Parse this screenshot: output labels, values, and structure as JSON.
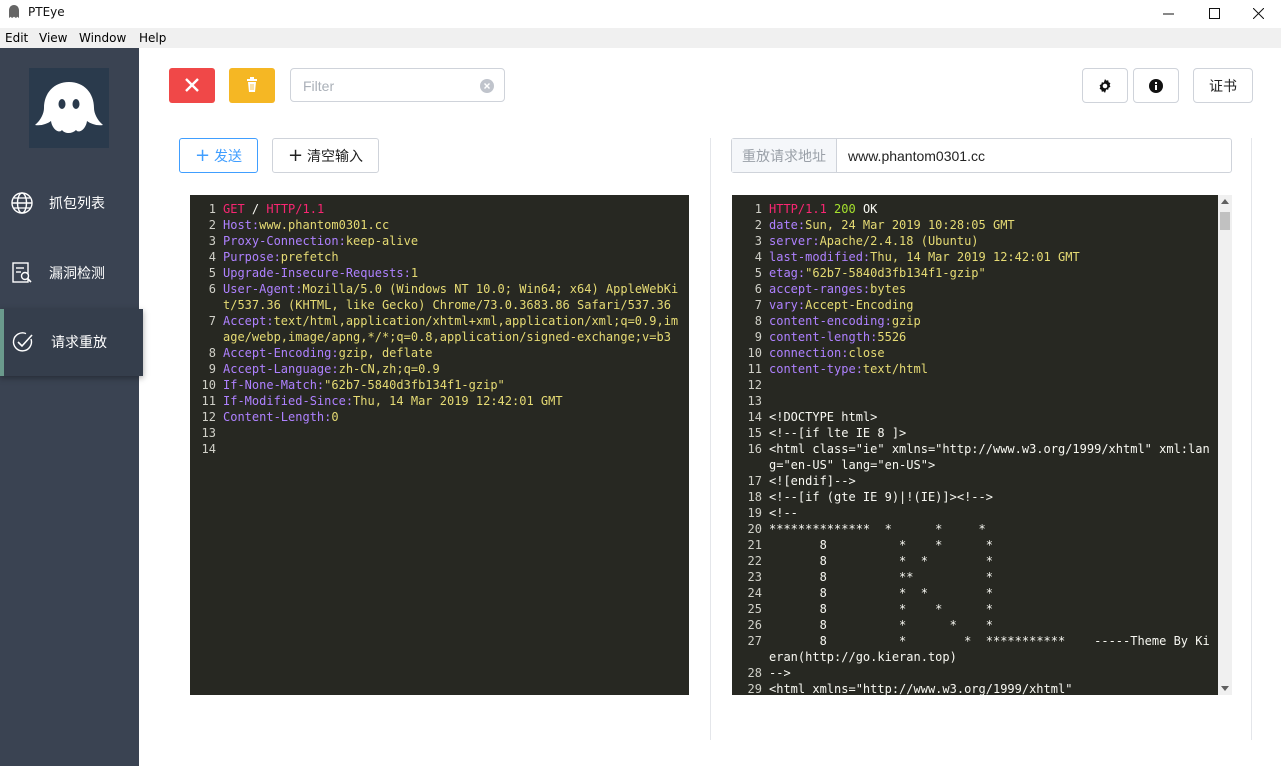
{
  "window": {
    "title": "PTEye"
  },
  "menu": [
    "Edit",
    "View",
    "Window",
    "Help"
  ],
  "sidebar": {
    "items": [
      {
        "label": "抓包列表",
        "icon": "globe-icon",
        "active": false
      },
      {
        "label": "漏洞检测",
        "icon": "report-icon",
        "active": false
      },
      {
        "label": "请求重放",
        "icon": "check-circle-icon",
        "active": true
      }
    ]
  },
  "toolbar": {
    "filter_placeholder": "Filter",
    "cert_label": "证书"
  },
  "actions": {
    "send_label": "发送",
    "clear_label": "清空输入"
  },
  "replay": {
    "address_label": "重放请求地址",
    "address_value": "www.phantom0301.cc"
  },
  "colors": {
    "sidebar": "#3a4352",
    "danger": "#f04848",
    "warning": "#f5b724",
    "primary": "#409eff",
    "editor_bg": "#272822"
  },
  "request": [
    [
      {
        "t": "GET",
        "c": "m"
      },
      {
        "t": " / ",
        "c": "w"
      },
      {
        "t": "HTTP/1.1",
        "c": "m"
      }
    ],
    [
      {
        "t": "Host:",
        "c": "k"
      },
      {
        "t": "www.phantom0301.cc",
        "c": "v"
      }
    ],
    [
      {
        "t": "Proxy-Connection:",
        "c": "k"
      },
      {
        "t": "keep-alive",
        "c": "v"
      }
    ],
    [
      {
        "t": "Purpose:",
        "c": "k"
      },
      {
        "t": "prefetch",
        "c": "v"
      }
    ],
    [
      {
        "t": "Upgrade-Insecure-Requests:",
        "c": "k"
      },
      {
        "t": "1",
        "c": "v"
      }
    ],
    [
      {
        "t": "User-Agent:",
        "c": "k"
      },
      {
        "t": "Mozilla/5.0 (Windows NT 10.0; Win64; x64) AppleWebKit/537.36 (KHTML, like Gecko) Chrome/73.0.3683.86 Safari/537.36",
        "c": "v"
      }
    ],
    [
      {
        "t": "Accept:",
        "c": "k"
      },
      {
        "t": "text/html,application/xhtml+xml,application/xml;q=0.9,image/webp,image/apng,*/*;q=0.8,application/signed-exchange;v=b3",
        "c": "v"
      }
    ],
    [
      {
        "t": "Accept-Encoding:",
        "c": "k"
      },
      {
        "t": "gzip, deflate",
        "c": "v"
      }
    ],
    [
      {
        "t": "Accept-Language:",
        "c": "k"
      },
      {
        "t": "zh-CN,zh;q=0.9",
        "c": "v"
      }
    ],
    [
      {
        "t": "If-None-Match:",
        "c": "k"
      },
      {
        "t": "\"62b7-5840d3fb134f1-gzip\"",
        "c": "v"
      }
    ],
    [
      {
        "t": "If-Modified-Since:",
        "c": "k"
      },
      {
        "t": "Thu, 14 Mar 2019 12:42:01 GMT",
        "c": "v"
      }
    ],
    [
      {
        "t": "Content-Length:",
        "c": "k"
      },
      {
        "t": "0",
        "c": "v"
      }
    ],
    [],
    []
  ],
  "response": [
    [
      {
        "t": "HTTP/1.1",
        "c": "m"
      },
      {
        "t": " ",
        "c": "w"
      },
      {
        "t": "200",
        "c": "g"
      },
      {
        "t": " OK",
        "c": "w"
      }
    ],
    [
      {
        "t": "date:",
        "c": "k"
      },
      {
        "t": "Sun, 24 Mar 2019 10:28:05 GMT",
        "c": "v"
      }
    ],
    [
      {
        "t": "server:",
        "c": "k"
      },
      {
        "t": "Apache/2.4.18 (Ubuntu)",
        "c": "v"
      }
    ],
    [
      {
        "t": "last-modified:",
        "c": "k"
      },
      {
        "t": "Thu, 14 Mar 2019 12:42:01 GMT",
        "c": "v"
      }
    ],
    [
      {
        "t": "etag:",
        "c": "k"
      },
      {
        "t": "\"62b7-5840d3fb134f1-gzip\"",
        "c": "v"
      }
    ],
    [
      {
        "t": "accept-ranges:",
        "c": "k"
      },
      {
        "t": "bytes",
        "c": "v"
      }
    ],
    [
      {
        "t": "vary:",
        "c": "k"
      },
      {
        "t": "Accept-Encoding",
        "c": "v"
      }
    ],
    [
      {
        "t": "content-encoding:",
        "c": "k"
      },
      {
        "t": "gzip",
        "c": "v"
      }
    ],
    [
      {
        "t": "content-length:",
        "c": "k"
      },
      {
        "t": "5526",
        "c": "v"
      }
    ],
    [
      {
        "t": "connection:",
        "c": "k"
      },
      {
        "t": "close",
        "c": "v"
      }
    ],
    [
      {
        "t": "content-type:",
        "c": "k"
      },
      {
        "t": "text/html",
        "c": "v"
      }
    ],
    [],
    [],
    [
      {
        "t": "<!DOCTYPE html>",
        "c": "w"
      }
    ],
    [
      {
        "t": "<!--[if lte IE 8 ]>",
        "c": "w"
      }
    ],
    [
      {
        "t": "<html class=\"ie\" xmlns=\"http://www.w3.org/1999/xhtml\" xml:lang=\"en-US\" lang=\"en-US\">",
        "c": "w"
      }
    ],
    [
      {
        "t": "<![endif]-->",
        "c": "w"
      }
    ],
    [
      {
        "t": "<!--[if (gte IE 9)|!(IE)]><!-->",
        "c": "w"
      }
    ],
    [
      {
        "t": "<!--",
        "c": "w"
      }
    ],
    [
      {
        "t": "**************  *      *     *",
        "c": "w"
      }
    ],
    [
      {
        "t": "       8          *    *      *",
        "c": "w"
      }
    ],
    [
      {
        "t": "       8          *  *        *",
        "c": "w"
      }
    ],
    [
      {
        "t": "       8          **          *",
        "c": "w"
      }
    ],
    [
      {
        "t": "       8          *  *        *",
        "c": "w"
      }
    ],
    [
      {
        "t": "       8          *    *      *",
        "c": "w"
      }
    ],
    [
      {
        "t": "       8          *      *    *",
        "c": "w"
      }
    ],
    [
      {
        "t": "       8          *        *  ***********    -----Theme By Kieran(http://go.kieran.top)",
        "c": "w"
      }
    ],
    [
      {
        "t": "-->",
        "c": "w"
      }
    ],
    [
      {
        "t": "<html xmlns=\"http://www.w3.org/1999/xhtml\"",
        "c": "w"
      }
    ]
  ]
}
